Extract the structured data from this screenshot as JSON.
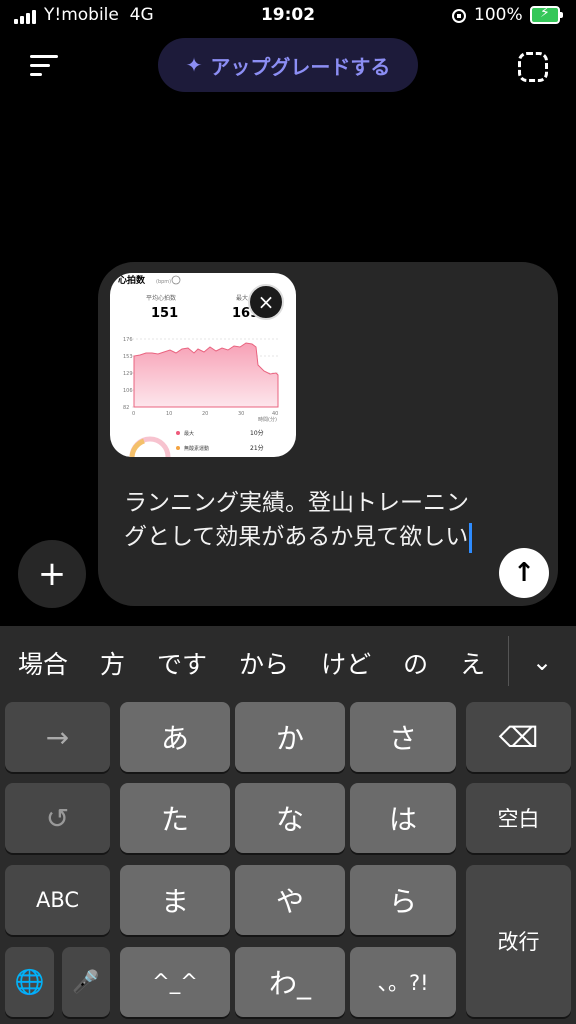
{
  "status_bar": {
    "carrier": "Y!mobile",
    "network": "4G",
    "time": "19:02",
    "battery": "100%"
  },
  "header": {
    "upgrade_icon": "✦",
    "upgrade_label": "アップグレードする"
  },
  "composer": {
    "attachment_title": "心拍数",
    "attachment_unit": "(bpm)",
    "attachment_avg_label": "平均心拍数",
    "attachment_avg_value": "151",
    "attachment_max_label": "最大",
    "attachment_max_value": "169",
    "attachment_y_ticks": [
      "176",
      "153",
      "129",
      "106",
      "82"
    ],
    "attachment_x_ticks": [
      "0",
      "10",
      "20",
      "30",
      "40"
    ],
    "attachment_x_unit": "時間(分)",
    "attachment_legend": [
      {
        "label": "最大",
        "value": "10分",
        "color": "#ee5a7a"
      },
      {
        "label": "無酸素運動",
        "value": "21分",
        "color": "#f4a340"
      }
    ],
    "text": "ランニング実績。登山トレーニングとして効果があるか見て欲しい",
    "close_icon": "×",
    "send_icon": "↑",
    "plus_icon": "+"
  },
  "keyboard": {
    "candidates": [
      "場合",
      "方",
      "です",
      "から",
      "けど",
      "の",
      "え"
    ],
    "collapse_icon": "⌄",
    "keys": {
      "next": "→",
      "a": "あ",
      "ka": "か",
      "sa": "さ",
      "delete": "⌫",
      "undo": "↺",
      "ta": "た",
      "na": "な",
      "ha": "は",
      "space": "空白",
      "abc": "ABC",
      "ma": "ま",
      "ya": "や",
      "ra": "ら",
      "enter": "改行",
      "globe": "🌐",
      "mic": "🎤",
      "emoticon": "^_^",
      "wa": "わ_",
      "punct": "、。?!"
    }
  }
}
